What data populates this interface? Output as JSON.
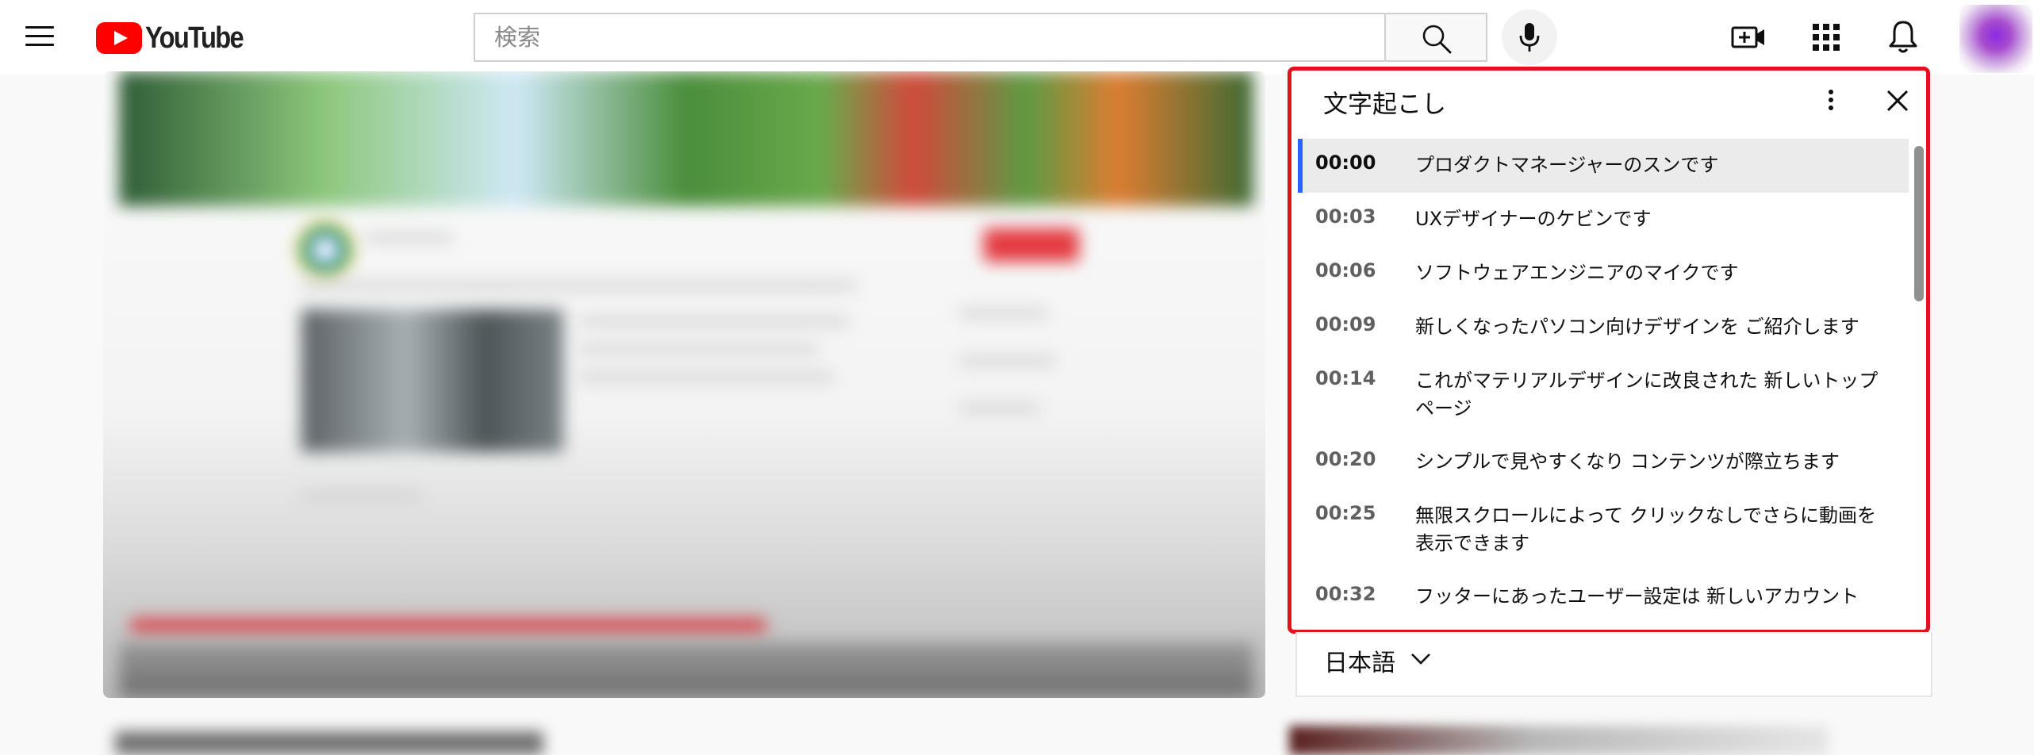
{
  "header": {
    "logo_text": "YouTube",
    "search_placeholder": "検索"
  },
  "transcript": {
    "title": "文字起こし",
    "active_index": 0,
    "segments": [
      {
        "time": "00:00",
        "text": "プロダクトマネージャーのスンです"
      },
      {
        "time": "00:03",
        "text": "UXデザイナーのケビンです"
      },
      {
        "time": "00:06",
        "text": "ソフトウェアエンジニアのマイクです"
      },
      {
        "time": "00:09",
        "text": "新しくなったパソコン向けデザインを ご紹介します"
      },
      {
        "time": "00:14",
        "text": "これがマテリアルデザインに改良された 新しいトップページ"
      },
      {
        "time": "00:20",
        "text": "シンプルで見やすくなり コンテンツが際立ちます"
      },
      {
        "time": "00:25",
        "text": "無限スクロールによって クリックなしでさらに動画を表示できます"
      },
      {
        "time": "00:32",
        "text": "フッターにあったユーザー設定は 新しいアカウント"
      }
    ],
    "language": "日本語"
  },
  "colors": {
    "highlight_border": "#e3111b",
    "active_indicator": "#2962ff",
    "brand": "#ff0000"
  },
  "icons": {
    "menu": "menu-icon",
    "search": "search-icon",
    "mic": "microphone-icon",
    "create": "video-add-icon",
    "apps": "apps-grid-icon",
    "notifications": "bell-icon",
    "more": "more-vert-icon",
    "close": "close-icon",
    "language": "chevron-down-icon"
  }
}
